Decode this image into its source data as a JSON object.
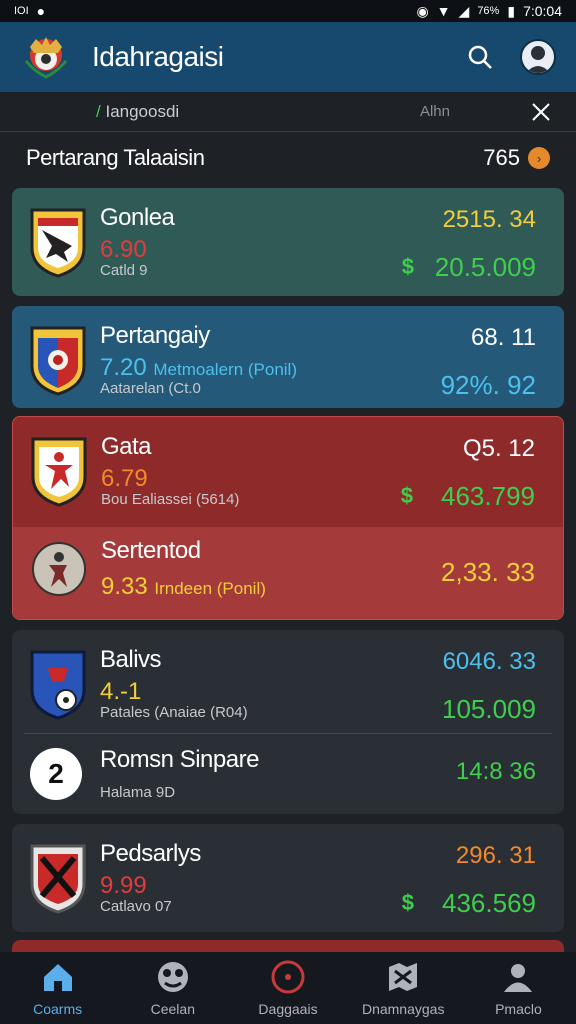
{
  "status": {
    "left_icons": "IOI",
    "battery": "76%",
    "time": "7:0:04"
  },
  "app": {
    "title": "Idahragaisi",
    "search_icon": "search-icon",
    "avatar_icon": "avatar"
  },
  "filter": {
    "slash": "/",
    "label": "Iangoosdi",
    "all": "Alhn",
    "close_icon": "close-icon"
  },
  "section": {
    "title": "Pertarang Talaaisin",
    "count": "765",
    "count_icon": "chevron-right-icon"
  },
  "colors": {
    "appbar": "#17496e",
    "green_card": "#2f5a56",
    "blue_card": "#24597a",
    "red_card": "#8e2a2a",
    "red_card_2": "#a53a3a",
    "dark_card": "#2a2e35",
    "green_value": "#3ecf4c",
    "yellow_value": "#f2cf3a",
    "red_value": "#e23c3c",
    "orange_value": "#f28a2a",
    "cyan_value": "#4bc1ec"
  },
  "teams": [
    {
      "name": "Gonlea",
      "rating": "6.90",
      "sub": "Catld 9",
      "value1": "2515. 34",
      "currency": "$",
      "value2": "20.5.009"
    },
    {
      "name": "Pertangaiy",
      "rating": "7.20",
      "rating_note": "Metmoalern (Ponil)",
      "sub": "Aatarelan (Ct.0",
      "value1": "68. 11",
      "value2": "92%. 92"
    },
    {
      "name": "Gata",
      "rating": "6.79",
      "sub": "Bou Ealiassei (5614)",
      "value1": "Q5. 12",
      "currency": "$",
      "value2": "463.799"
    },
    {
      "name": "Sertentod",
      "rating": "9.33",
      "rating_note": "Irndeen (Ponil)",
      "value1": "2,33. 33"
    },
    {
      "name": "Balivs",
      "rating": "4.-1",
      "sub": "Patales (Anaiae (R04)",
      "value1": "6046. 33",
      "value2": "105.009"
    },
    {
      "badge": "2",
      "name": "Romsn Sinpare",
      "sub": "Halama 9D",
      "value1": "14:8 36"
    },
    {
      "name": "Pedsarlys",
      "rating": "9.99",
      "sub": "Catlavo 07",
      "value1": "296. 31",
      "currency": "$",
      "value2": "436.569"
    }
  ],
  "nav": [
    {
      "label": "Coarms",
      "icon": "home-icon"
    },
    {
      "label": "Ceelan",
      "icon": "ball-icon"
    },
    {
      "label": "Daggaais",
      "icon": "target-icon"
    },
    {
      "label": "Dnamnaygas",
      "icon": "map-icon"
    },
    {
      "label": "Pmaclo",
      "icon": "profile-icon"
    }
  ]
}
